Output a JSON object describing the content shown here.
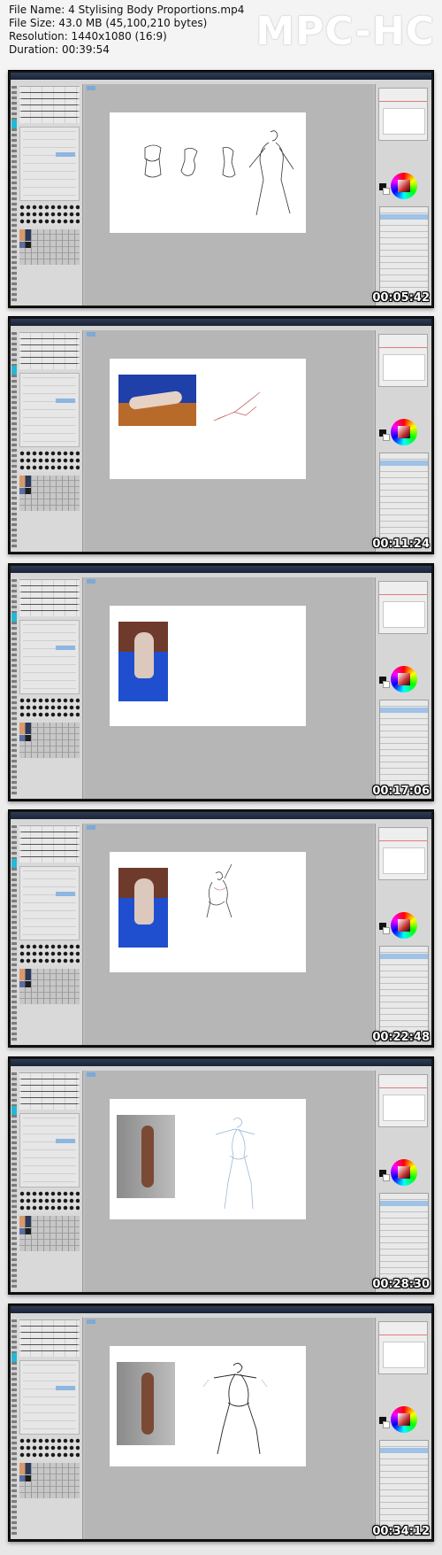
{
  "file_info": {
    "file_name_line": "File Name: 4 Stylising Body Proportions.mp4",
    "file_size_line": "File Size: 43.0 MB (45,100,210 bytes)",
    "resolution_line": "Resolution: 1440x1080 (16:9)",
    "duration_line": "Duration: 00:39:54"
  },
  "player_brand": "MPC-HC",
  "thumbnails": [
    {
      "timestamp": "00:05:42"
    },
    {
      "timestamp": "00:11:24"
    },
    {
      "timestamp": "00:17:06"
    },
    {
      "timestamp": "00:22:48"
    },
    {
      "timestamp": "00:28:30"
    },
    {
      "timestamp": "00:34:12"
    }
  ]
}
